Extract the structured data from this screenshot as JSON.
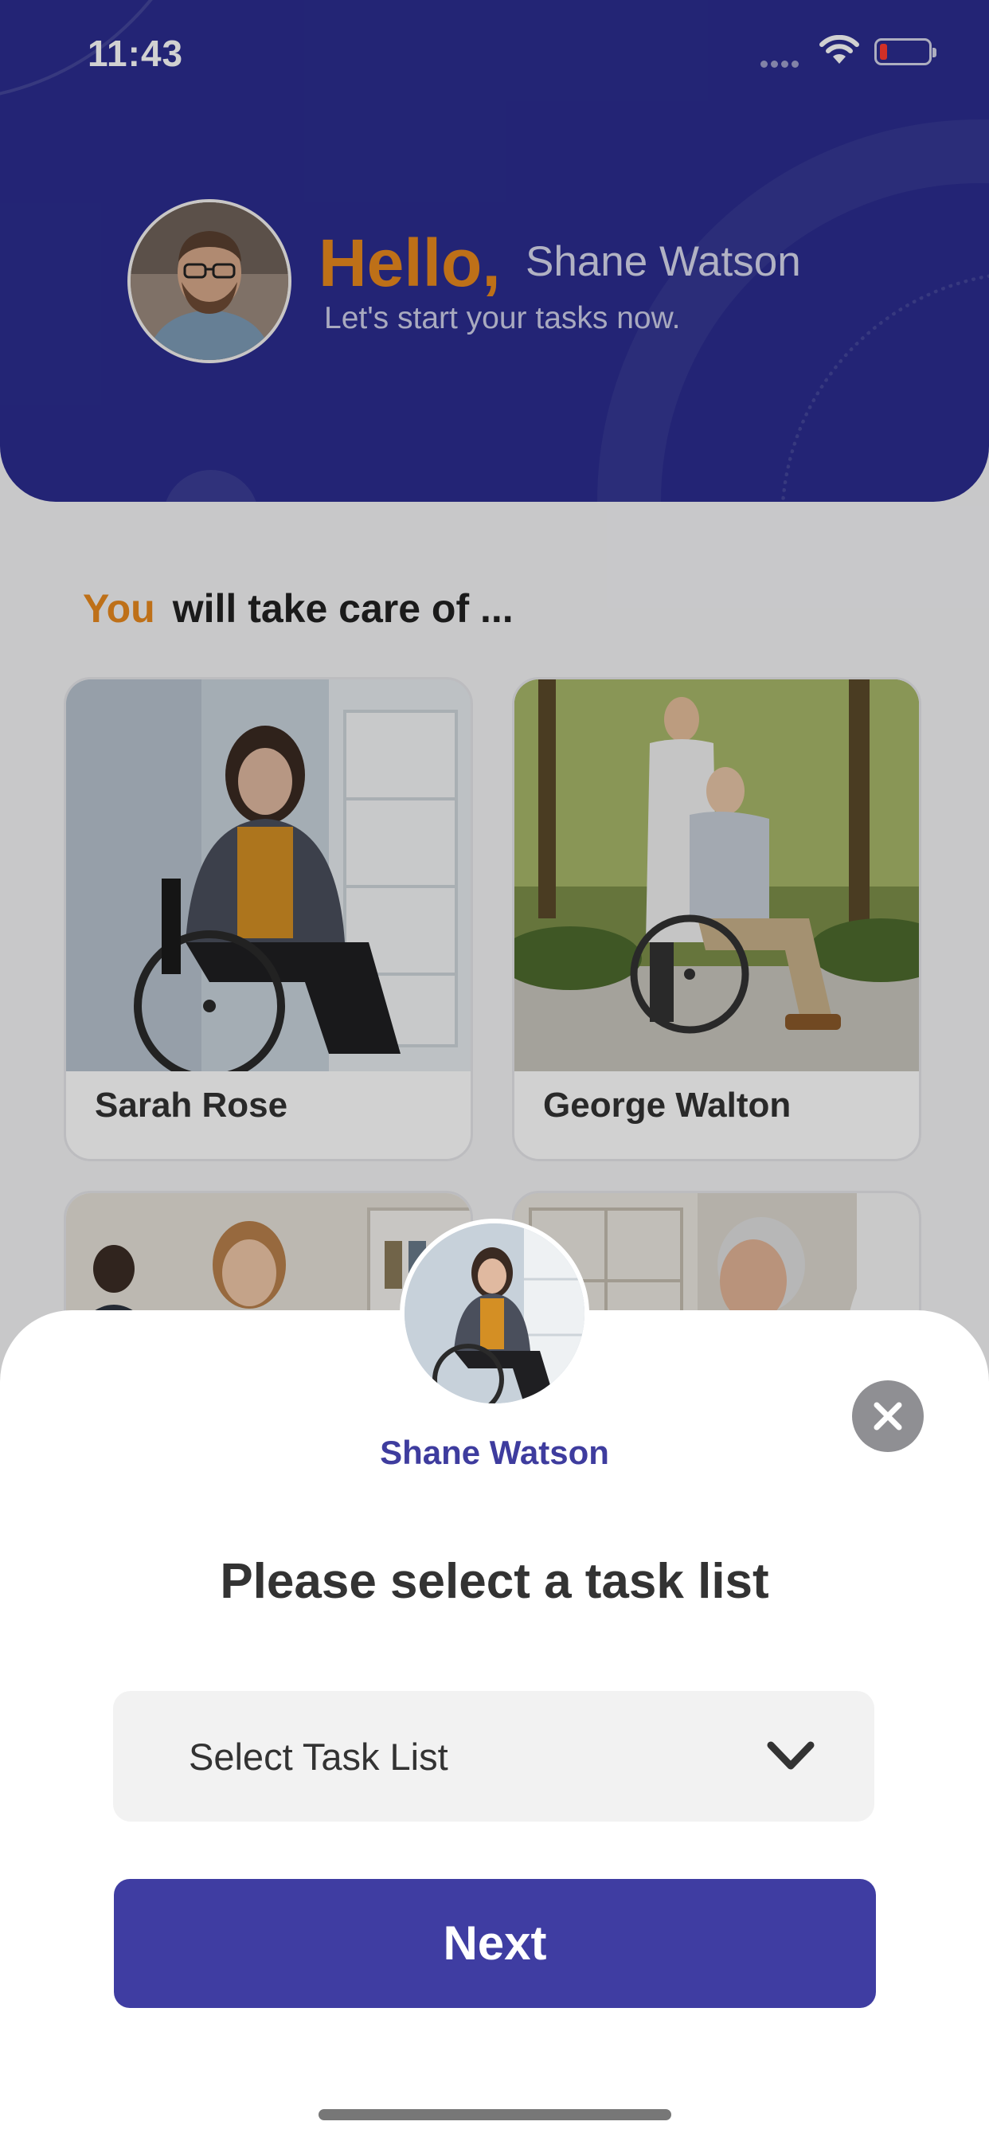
{
  "status_bar": {
    "time": "11:43"
  },
  "header": {
    "greeting": "Hello,",
    "user_name": "Shane Watson",
    "subtitle": "Let's start your tasks now."
  },
  "care_section": {
    "heading_highlight": "You",
    "heading_rest": "will take care of ..."
  },
  "patients": [
    {
      "name": "Sarah Rose"
    },
    {
      "name": "George Walton"
    }
  ],
  "modal": {
    "name": "Shane Watson",
    "title": "Please select a task list",
    "select_placeholder": "Select Task List",
    "next_label": "Next"
  },
  "colors": {
    "brand_blue": "#2b2d8f",
    "accent_orange": "#e8891e",
    "button_purple": "#3f3da2",
    "battery_low": "#ff3b30"
  }
}
